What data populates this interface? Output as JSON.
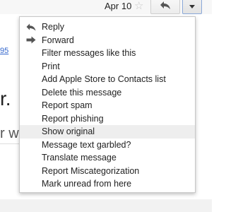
{
  "header": {
    "date": "Apr 10",
    "star_icon": "star-icon",
    "reply_icon": "reply-arrow-icon",
    "more_icon": "dropdown-triangle-icon"
  },
  "background": {
    "link_text": "95",
    "big_text": "r.",
    "partial_text": "r wa"
  },
  "menu": {
    "items": [
      {
        "label": "Reply",
        "icon": "reply-icon"
      },
      {
        "label": "Forward",
        "icon": "forward-icon"
      },
      {
        "label": "Filter messages like this"
      },
      {
        "label": "Print"
      },
      {
        "label": "Add Apple Store to Contacts list"
      },
      {
        "label": "Delete this message"
      },
      {
        "label": "Report spam"
      },
      {
        "label": "Report phishing"
      },
      {
        "label": "Show original",
        "highlighted": true
      },
      {
        "label": "Message text garbled?"
      },
      {
        "label": "Translate message"
      },
      {
        "label": "Report Miscategorization"
      },
      {
        "label": "Mark unread from here"
      }
    ]
  },
  "colors": {
    "link": "#3366cc",
    "menu_highlight": "#eeeeee",
    "icon_gray": "#555555"
  }
}
